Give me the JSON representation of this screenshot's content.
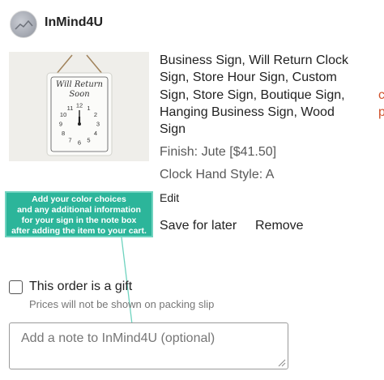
{
  "shop": {
    "name": "InMind4U"
  },
  "listing": {
    "title_lines": [
      "Business Sign, Will Return Clock",
      "Sign, Store Hour Sign, Custom",
      "Sign, Store Sign, Boutique Sign,",
      "Hanging Business Sign, Wood",
      "Sign"
    ],
    "variations": [
      "Finish: Jute [$41.50]",
      "Clock Hand Style: A"
    ],
    "edit_label": "Edit",
    "save_label": "Save for later",
    "remove_label": "Remove",
    "image_sign_text": [
      "Will Return",
      "Soon"
    ],
    "clock_numbers": [
      "12",
      "1",
      "2",
      "3",
      "4",
      "5",
      "6",
      "7",
      "8",
      "9",
      "10",
      "11"
    ],
    "edge_text_lines": [
      "c",
      "p"
    ]
  },
  "callout": {
    "lines": [
      "Add your color choices",
      "and any additional information",
      "for your sign in the note box",
      "after adding the item to your cart."
    ]
  },
  "gift": {
    "label": "This order is a gift",
    "note": "Prices will not be shown on packing slip"
  },
  "note_box": {
    "placeholder": "Add a note to InMind4U (optional)"
  },
  "colors": {
    "accent": "#2cb59a",
    "edge_text": "#d0512b"
  },
  "icons": [
    "shop-avatar",
    "arrow-icon",
    "resize-grip-icon"
  ]
}
